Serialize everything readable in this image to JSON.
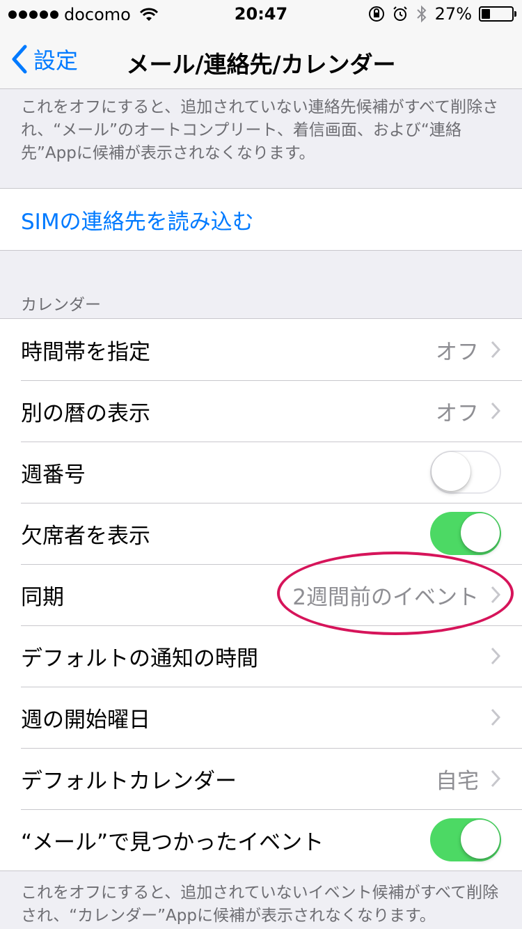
{
  "status_bar": {
    "carrier": "docomo",
    "time": "20:47",
    "battery_percent": "27%",
    "battery_level": 0.27
  },
  "nav": {
    "back_label": "設定",
    "title": "メール/連絡先/カレンダー"
  },
  "contacts_footer": "これをオフにすると、追加されていない連絡先候補がすべて削除され、“メール”のオートコンプリート、着信画面、および“連絡先”Appに候補が表示されなくなります。",
  "sim_import_label": "SIMの連絡先を読み込む",
  "calendar": {
    "header": "カレンダー",
    "rows": [
      {
        "label": "時間帯を指定",
        "value": "オフ"
      },
      {
        "label": "別の暦の表示",
        "value": "オフ"
      },
      {
        "label": "週番号",
        "toggle": "off"
      },
      {
        "label": "欠席者を表示",
        "toggle": "on"
      },
      {
        "label": "同期",
        "value": "2週間前のイベント"
      },
      {
        "label": "デフォルトの通知の時間",
        "value": ""
      },
      {
        "label": "週の開始曜日",
        "value": ""
      },
      {
        "label": "デフォルトカレンダー",
        "value": "自宅"
      },
      {
        "label": "“メール”で見つかったイベント",
        "toggle": "on"
      }
    ],
    "footer": "これをオフにすると、追加されていないイベント候補がすべて削除され、“カレンダー”Appに候補が表示されなくなります。"
  },
  "colors": {
    "accent": "#007aff",
    "switch_on": "#4cd964",
    "annotation": "#d6145a"
  }
}
